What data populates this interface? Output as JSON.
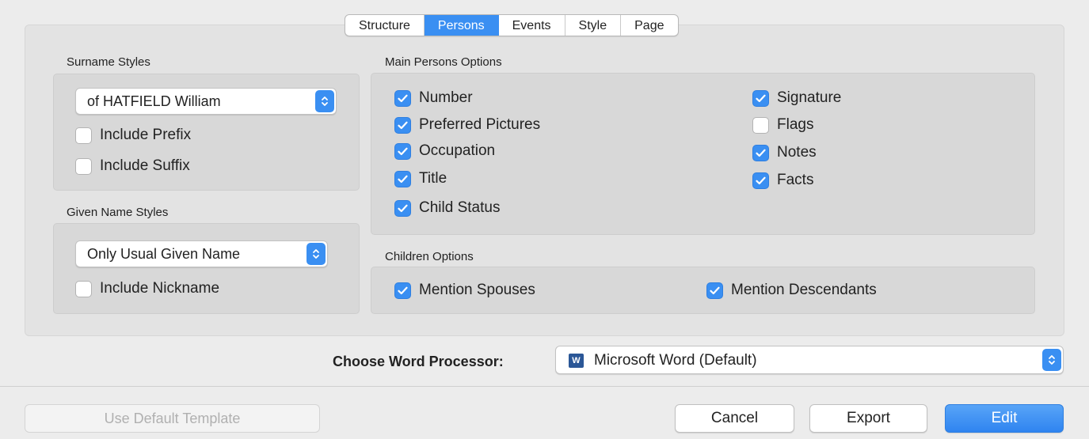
{
  "tabs": [
    {
      "label": "Structure",
      "active": false
    },
    {
      "label": "Persons",
      "active": true
    },
    {
      "label": "Events",
      "active": false
    },
    {
      "label": "Style",
      "active": false
    },
    {
      "label": "Page",
      "active": false
    }
  ],
  "surname": {
    "heading": "Surname Styles",
    "selected": "of HATFIELD William",
    "options": [
      {
        "label": "Include Prefix",
        "checked": false
      },
      {
        "label": "Include Suffix",
        "checked": false
      }
    ]
  },
  "given": {
    "heading": "Given Name Styles",
    "selected": "Only Usual Given Name",
    "options": [
      {
        "label": "Include Nickname",
        "checked": false
      }
    ]
  },
  "main_persons": {
    "heading": "Main Persons Options",
    "left": [
      {
        "label": "Number",
        "checked": true
      },
      {
        "label": "Preferred Pictures",
        "checked": true
      },
      {
        "label": "Occupation",
        "checked": true
      },
      {
        "label": "Title",
        "checked": true
      },
      {
        "label": "Child Status",
        "checked": true
      }
    ],
    "right": [
      {
        "label": "Signature",
        "checked": true
      },
      {
        "label": "Flags",
        "checked": false
      },
      {
        "label": "Notes",
        "checked": true
      },
      {
        "label": "Facts",
        "checked": true
      }
    ]
  },
  "children": {
    "heading": "Children Options",
    "options": [
      {
        "label": "Mention Spouses",
        "checked": true
      },
      {
        "label": "Mention Descendants",
        "checked": true
      }
    ]
  },
  "word_processor": {
    "label": "Choose Word Processor:",
    "selected": "Microsoft Word (Default)",
    "icon": "microsoft-word-icon",
    "icon_letter": "W"
  },
  "buttons": {
    "use_default": "Use Default Template",
    "cancel": "Cancel",
    "export": "Export",
    "edit": "Edit"
  },
  "colors": {
    "accent": "#3a8ff2",
    "panel": "#e3e3e3",
    "box": "#d8d8d8"
  }
}
